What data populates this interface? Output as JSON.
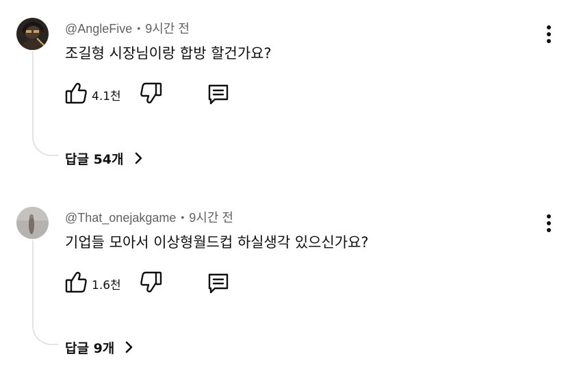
{
  "comments": [
    {
      "author": "@AngleFive",
      "separator": "•",
      "time": "9시간 전",
      "text": "조길형 시장님이랑 합방 할건가요?",
      "likes": "4.1천",
      "replies_label": "답글 54개",
      "avatar_icon": "avatar-dark-character",
      "more_icon": "vertical-dots-icon"
    },
    {
      "author": "@That_onejakgame",
      "separator": "•",
      "time": "9시간 전",
      "text": "기업들 모아서 이상형월드컵 하실생각 있으신가요?",
      "likes": "1.6천",
      "replies_label": "답글 9개",
      "avatar_icon": "avatar-gray-figure",
      "more_icon": "vertical-dots-icon"
    }
  ],
  "icons": {
    "like": "thumbs-up-icon",
    "dislike": "thumbs-down-icon",
    "reply": "comment-bubble-icon",
    "expand": "chevron-right-icon"
  },
  "colors": {
    "text": "#0f0f0f",
    "secondary": "#606060",
    "thread_line": "#e3e3e3"
  }
}
